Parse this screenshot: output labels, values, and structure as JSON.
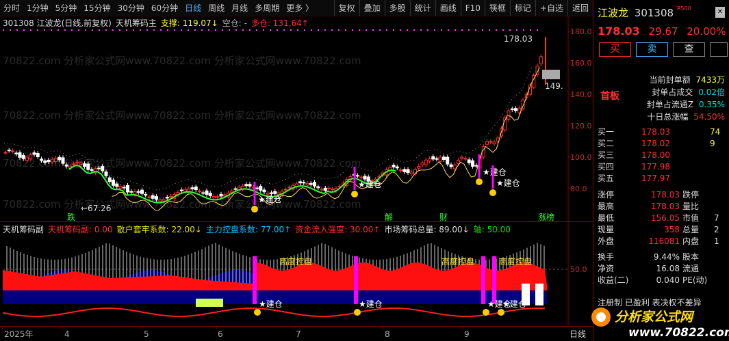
{
  "toolbar": {
    "periods": [
      "分时",
      "1分钟",
      "5分钟",
      "15分钟",
      "30分钟",
      "60分钟",
      "日线",
      "周线",
      "月线",
      "多周期",
      "更多 〉"
    ],
    "active_period": "日线",
    "buttons": [
      "复权",
      "叠加",
      "多股",
      "统计",
      "画线",
      "F10",
      "筷框",
      "标记",
      "+自选",
      "返回"
    ]
  },
  "main_chart": {
    "stock_label": "301308 江波龙(日线,前复权)",
    "indicator_name": "天机筹码主",
    "support_label": "支撑: 119.07↓",
    "empty_label": "空仓: -",
    "long_label": "多仓: 131.64↑",
    "price_axis": [
      "180.0",
      "160.0",
      "140.0",
      "120.0",
      "100.0",
      "80.0"
    ],
    "high_marker": "178.03",
    "low_marker": "67.26",
    "current_price_tag": "149.",
    "annotations": [
      "建仓",
      "建仓",
      "建仓",
      "建仓"
    ],
    "bottom_tags": [
      "跌",
      "解",
      "财",
      "涨榜"
    ],
    "watermark": "70822.com 分析家公式网www.70822.com 分析家公式网www.70822.com"
  },
  "sub_chart": {
    "indicator_name": "天机筹码副",
    "values": [
      {
        "label": "天机筹码副: 0.00",
        "color": "#ff3030"
      },
      {
        "label": "散户套牢系数: 22.00↓",
        "color": "#e0e000"
      },
      {
        "label": "主力控盘系数: 77.00↑",
        "color": "#00c8ff"
      },
      {
        "label": "资金流入强度: 30.00↑",
        "color": "#ff3030"
      },
      {
        "label": "市场筹码总量: 89.00↓",
        "color": "#dddddd"
      },
      {
        "label": "轴: 50.00",
        "color": "#00e000"
      }
    ],
    "axis": [
      "50.0"
    ],
    "high_control_label": "高度控盘",
    "build_label": "建仓"
  },
  "date_axis": {
    "labels": [
      "2025年",
      "4",
      "5",
      "6",
      "7",
      "8",
      "9"
    ],
    "period": "日线"
  },
  "quote": {
    "name": "江波龙",
    "code": "301308",
    "badge": "R500",
    "price": "178.03",
    "change": "29.67",
    "pct": "20.00%",
    "buy_btn": "买",
    "sell_btn": "卖",
    "query_btn": "查",
    "seal_amount_label": "当前封单额",
    "seal_amount": "7433万",
    "first_board": "首板",
    "seal_ratio_label": "封单占成交",
    "seal_ratio": "0.02倍",
    "seal_float_label": "封单占流通Z",
    "seal_float": "0.35%",
    "ten_day_label": "十日总涨幅",
    "ten_day": "54.50%",
    "bids": [
      {
        "label": "买一",
        "price": "178.03",
        "vol": "74"
      },
      {
        "label": "买二",
        "price": "178.02",
        "vol": "9"
      },
      {
        "label": "买三",
        "price": "178.00",
        "vol": ""
      },
      {
        "label": "买四",
        "price": "177.98",
        "vol": ""
      },
      {
        "label": "买五",
        "price": "177.97",
        "vol": ""
      }
    ],
    "stats": [
      {
        "label": "涨停",
        "value": "178.03",
        "label2": "跌停",
        "value2": ""
      },
      {
        "label": "最高",
        "value": "178.03",
        "label2": "量比",
        "value2": ""
      },
      {
        "label": "最低",
        "value": "156.05",
        "label2": "市值",
        "value2": "7"
      },
      {
        "label": "现量",
        "value": "358",
        "label2": "总量",
        "value2": "2"
      },
      {
        "label": "外盘",
        "value": "116081",
        "label2": "内盘",
        "value2": "1"
      },
      {
        "label": "换手",
        "value": "9.44%",
        "label2": "股本",
        "value2": ""
      },
      {
        "label": "净资",
        "value": "16.08",
        "label2": "流通",
        "value2": ""
      },
      {
        "label": "收益(二)",
        "value": "0.040",
        "label2": "PE(动)",
        "value2": ""
      }
    ],
    "footer_text": "注册制 已盈利 表决权不差异"
  },
  "logo": {
    "text": "分析家公式网",
    "url": "www.70822.com"
  },
  "colors": {
    "up": "#ff3030",
    "down": "#00e0e0",
    "accent": "#4fb3ff",
    "bg": "#000000"
  }
}
